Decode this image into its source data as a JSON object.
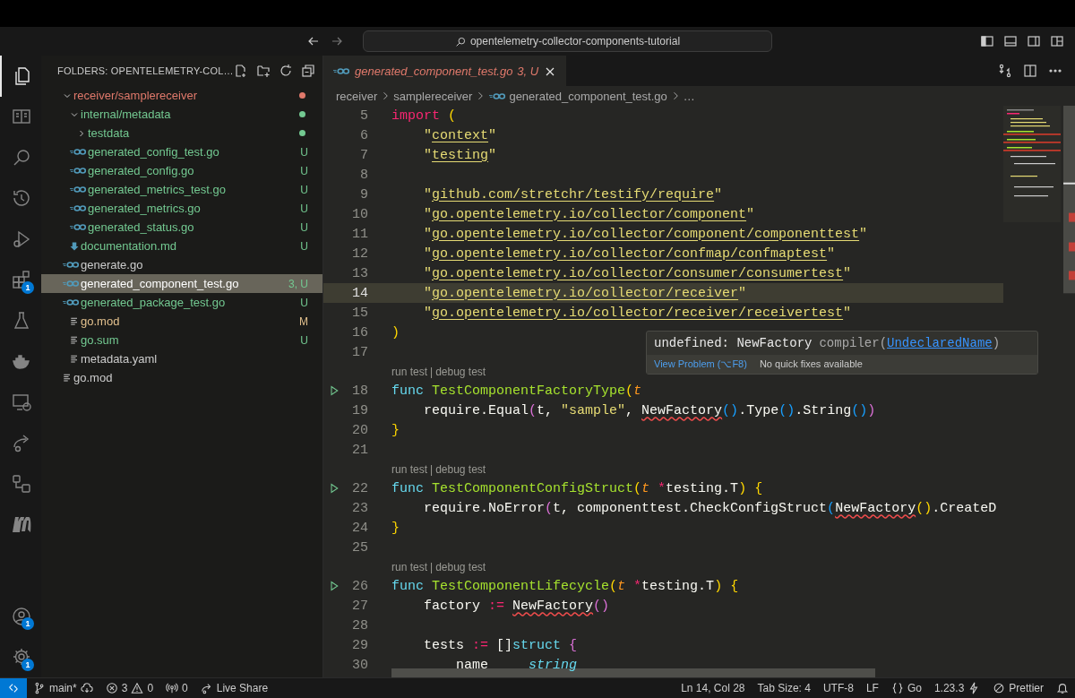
{
  "title_bar": {
    "search": "opentelemetry-collector-components-tutorial"
  },
  "activity_bar": {
    "top": [
      {
        "kind": "files",
        "selected": true
      },
      {
        "kind": "book",
        "selected": false
      },
      {
        "kind": "search",
        "selected": false
      },
      {
        "kind": "history",
        "selected": false
      },
      {
        "kind": "debug",
        "selected": false
      },
      {
        "kind": "extensions",
        "selected": false,
        "badge": "1"
      },
      {
        "kind": "flask",
        "selected": false
      },
      {
        "kind": "docker",
        "selected": false
      },
      {
        "kind": "remote",
        "selected": false
      },
      {
        "kind": "share",
        "selected": false
      },
      {
        "kind": "flow",
        "selected": false
      },
      {
        "kind": "mlogo",
        "selected": false
      }
    ],
    "bottom": [
      {
        "kind": "account",
        "selected": false,
        "badge": "1"
      },
      {
        "kind": "gear",
        "selected": false,
        "badge": "1"
      }
    ]
  },
  "sidebar": {
    "title": "FOLDERS: OPENTELEMETRY-COL…",
    "tree": [
      {
        "label": "receiver/samplereceiver",
        "kind": "folder",
        "expanded": true,
        "color": "#e0796b",
        "dot": true,
        "selected": false,
        "children": [
          {
            "label": "internal/metadata",
            "kind": "folder",
            "expanded": true,
            "color": "#73c991",
            "dot": true,
            "selected": false,
            "children": [
              {
                "label": "testdata",
                "kind": "folder",
                "expanded": false,
                "color": "#73c991",
                "dot": true,
                "selected": false
              },
              {
                "label": "generated_config_test.go",
                "kind": "go",
                "color": "#73c991",
                "badge": "U",
                "selected": false
              },
              {
                "label": "generated_config.go",
                "kind": "go",
                "color": "#73c991",
                "badge": "U",
                "selected": false
              },
              {
                "label": "generated_metrics_test.go",
                "kind": "go",
                "color": "#73c991",
                "badge": "U",
                "selected": false
              },
              {
                "label": "generated_metrics.go",
                "kind": "go",
                "color": "#73c991",
                "badge": "U",
                "selected": false
              },
              {
                "label": "generated_status.go",
                "kind": "go",
                "color": "#73c991",
                "badge": "U",
                "selected": false
              }
            ]
          },
          {
            "label": "documentation.md",
            "kind": "md",
            "color": "#73c991",
            "badge": "U",
            "selected": false
          },
          {
            "label": "generate.go",
            "kind": "go",
            "color": "#cccccc",
            "selected": false
          },
          {
            "label": "generated_component_test.go",
            "kind": "go",
            "color": "#73c991",
            "badge": "3, U",
            "selected": true
          },
          {
            "label": "generated_package_test.go",
            "kind": "go",
            "color": "#73c991",
            "badge": "U",
            "selected": false
          },
          {
            "label": "go.mod",
            "kind": "text",
            "color": "#e2c08d",
            "badge": "M",
            "selected": false
          },
          {
            "label": "go.sum",
            "kind": "text",
            "color": "#73c991",
            "badge": "U",
            "selected": false
          },
          {
            "label": "metadata.yaml",
            "kind": "text",
            "color": "#cccccc",
            "selected": false
          }
        ]
      },
      {
        "label": "go.mod",
        "kind": "text",
        "color": "#cccccc",
        "selected": false
      }
    ]
  },
  "editor": {
    "tabs": [
      {
        "label": "generated_component_test.go",
        "badge": "3, U",
        "selected": true
      }
    ],
    "breadcrumbs": [
      "receiver",
      "samplereceiver",
      "generated_component_test.go",
      "…"
    ],
    "lines": [
      {
        "kind": "code",
        "n": "5",
        "tokens": [
          {
            "kind": "kw",
            "text": "import"
          },
          {
            "kind": "b1",
            "text": " ("
          }
        ]
      },
      {
        "kind": "code",
        "n": "6",
        "tokens": [
          {
            "kind": "str",
            "text": "    \""
          },
          {
            "kind": "link",
            "text": "context"
          },
          {
            "kind": "str",
            "text": "\""
          }
        ]
      },
      {
        "kind": "code",
        "n": "7",
        "tokens": [
          {
            "kind": "str",
            "text": "    \""
          },
          {
            "kind": "link",
            "text": "testing"
          },
          {
            "kind": "str",
            "text": "\""
          }
        ]
      },
      {
        "kind": "code",
        "n": "8"
      },
      {
        "kind": "code",
        "n": "9",
        "tokens": [
          {
            "kind": "str",
            "text": "    \""
          },
          {
            "kind": "link",
            "text": "github.com/stretchr/testify/require"
          },
          {
            "kind": "str",
            "text": "\""
          }
        ]
      },
      {
        "kind": "code",
        "n": "10",
        "tokens": [
          {
            "kind": "str",
            "text": "    \""
          },
          {
            "kind": "link",
            "text": "go.opentelemetry.io/collector/component"
          },
          {
            "kind": "str",
            "text": "\""
          }
        ]
      },
      {
        "kind": "code",
        "n": "11",
        "tokens": [
          {
            "kind": "str",
            "text": "    \""
          },
          {
            "kind": "link",
            "text": "go.opentelemetry.io/collector/component/componenttest"
          },
          {
            "kind": "str",
            "text": "\""
          }
        ]
      },
      {
        "kind": "code",
        "n": "12",
        "tokens": [
          {
            "kind": "str",
            "text": "    \""
          },
          {
            "kind": "link",
            "text": "go.opentelemetry.io/collector/confmap/confmaptest"
          },
          {
            "kind": "str",
            "text": "\""
          }
        ]
      },
      {
        "kind": "code",
        "n": "13",
        "tokens": [
          {
            "kind": "str",
            "text": "    \""
          },
          {
            "kind": "link",
            "text": "go.opentelemetry.io/collector/consumer/consumertest"
          },
          {
            "kind": "str",
            "text": "\""
          }
        ]
      },
      {
        "kind": "code",
        "n": "14",
        "current": true,
        "tokens": [
          {
            "kind": "str",
            "text": "    \""
          },
          {
            "kind": "link",
            "text": "go.opentelemetry.io/collector/receiver"
          },
          {
            "kind": "str",
            "text": "\""
          }
        ]
      },
      {
        "kind": "code",
        "n": "15",
        "tokens": [
          {
            "kind": "str",
            "text": "    \""
          },
          {
            "kind": "link",
            "text": "go.opentelemetry.io/collector/receiver/receivertest"
          },
          {
            "kind": "str",
            "text": "\""
          }
        ]
      },
      {
        "kind": "code",
        "n": "16",
        "tokens": [
          {
            "kind": "b1",
            "text": ")"
          }
        ]
      },
      {
        "kind": "code",
        "n": "17"
      },
      {
        "kind": "lens",
        "links": [
          "run test",
          "debug test"
        ],
        "separator": "|"
      },
      {
        "kind": "code",
        "n": "18",
        "run": true,
        "tokens": [
          {
            "kind": "kw2",
            "text": "func "
          },
          {
            "kind": "fn",
            "text": "TestComponentFactoryType"
          },
          {
            "kind": "b1",
            "text": "("
          },
          {
            "kind": "param",
            "text": "t"
          }
        ]
      },
      {
        "kind": "code",
        "n": "19",
        "tokens": [
          {
            "kind": "p",
            "text": "    require.Equal"
          },
          {
            "kind": "b2",
            "text": "("
          },
          {
            "kind": "p",
            "text": "t, "
          },
          {
            "kind": "str",
            "text": "\"sample\""
          },
          {
            "kind": "p",
            "text": ", "
          },
          {
            "kind": "err",
            "text": "NewFactory"
          },
          {
            "kind": "b3",
            "text": "()"
          },
          {
            "kind": "p",
            "text": ".Type"
          },
          {
            "kind": "b3",
            "text": "()"
          },
          {
            "kind": "p",
            "text": ".String"
          },
          {
            "kind": "b3",
            "text": "()"
          },
          {
            "kind": "b2",
            "text": ")"
          }
        ]
      },
      {
        "kind": "code",
        "n": "20",
        "tokens": [
          {
            "kind": "b1",
            "text": "}"
          }
        ]
      },
      {
        "kind": "code",
        "n": "21"
      },
      {
        "kind": "lens",
        "links": [
          "run test",
          "debug test"
        ],
        "separator": "|"
      },
      {
        "kind": "code",
        "n": "22",
        "run": true,
        "tokens": [
          {
            "kind": "kw2",
            "text": "func "
          },
          {
            "kind": "fn",
            "text": "TestComponentConfigStruct"
          },
          {
            "kind": "b1",
            "text": "("
          },
          {
            "kind": "param",
            "text": "t"
          },
          {
            "kind": "kw",
            "text": " *"
          },
          {
            "kind": "p",
            "text": "testing.T"
          },
          {
            "kind": "b1",
            "text": ") {"
          }
        ]
      },
      {
        "kind": "code",
        "n": "23",
        "tokens": [
          {
            "kind": "p",
            "text": "    require.NoError"
          },
          {
            "kind": "b2",
            "text": "("
          },
          {
            "kind": "p",
            "text": "t, componenttest.CheckConfigStruct"
          },
          {
            "kind": "b3",
            "text": "("
          },
          {
            "kind": "err",
            "text": "NewFactory"
          },
          {
            "kind": "b1",
            "text": "()"
          },
          {
            "kind": "p",
            "text": ".CreateD"
          }
        ]
      },
      {
        "kind": "code",
        "n": "24",
        "tokens": [
          {
            "kind": "b1",
            "text": "}"
          }
        ]
      },
      {
        "kind": "code",
        "n": "25"
      },
      {
        "kind": "lens",
        "links": [
          "run test",
          "debug test"
        ],
        "separator": "|"
      },
      {
        "kind": "code",
        "n": "26",
        "run": true,
        "tokens": [
          {
            "kind": "kw2",
            "text": "func "
          },
          {
            "kind": "fn",
            "text": "TestComponentLifecycle"
          },
          {
            "kind": "b1",
            "text": "("
          },
          {
            "kind": "param",
            "text": "t"
          },
          {
            "kind": "kw",
            "text": " *"
          },
          {
            "kind": "p",
            "text": "testing.T"
          },
          {
            "kind": "b1",
            "text": ") {"
          }
        ]
      },
      {
        "kind": "code",
        "n": "27",
        "tokens": [
          {
            "kind": "p",
            "text": "    factory "
          },
          {
            "kind": "kw",
            "text": ":= "
          },
          {
            "kind": "err",
            "text": "NewFactory"
          },
          {
            "kind": "b2",
            "text": "()"
          }
        ]
      },
      {
        "kind": "code",
        "n": "28"
      },
      {
        "kind": "code",
        "n": "29",
        "tokens": [
          {
            "kind": "p",
            "text": "    tests "
          },
          {
            "kind": "kw",
            "text": ":="
          },
          {
            "kind": "p",
            "text": " []"
          },
          {
            "kind": "kw2",
            "text": "struct"
          },
          {
            "kind": "b2",
            "text": " {"
          }
        ]
      },
      {
        "kind": "code",
        "n": "30",
        "tokens": [
          {
            "kind": "p",
            "text": "        name     "
          },
          {
            "kind": "type",
            "text": "string"
          }
        ]
      }
    ],
    "hover": {
      "message": "undefined: NewFactory",
      "source": "compiler(",
      "code": "UndeclaredName",
      "close": ")",
      "action": "View Problem (⌥F8)",
      "note": "No quick fixes available"
    }
  },
  "status_bar": {
    "left": [
      {
        "kind": "remote"
      },
      {
        "kind": "branch",
        "text": "main*"
      },
      {
        "kind": "problems",
        "errors": "3",
        "warnings": "0"
      },
      {
        "kind": "ports",
        "text": "0"
      },
      {
        "kind": "liveshare",
        "text": "Live Share"
      }
    ],
    "right": [
      {
        "kind": "plain",
        "text": "Ln 14, Col 28"
      },
      {
        "kind": "plain",
        "text": "Tab Size: 4"
      },
      {
        "kind": "plain",
        "text": "UTF-8"
      },
      {
        "kind": "plain",
        "text": "LF"
      },
      {
        "kind": "language",
        "text": "Go"
      },
      {
        "kind": "version",
        "text": "1.23.3"
      },
      {
        "kind": "prettier",
        "text": "Prettier"
      },
      {
        "kind": "bell"
      }
    ]
  }
}
